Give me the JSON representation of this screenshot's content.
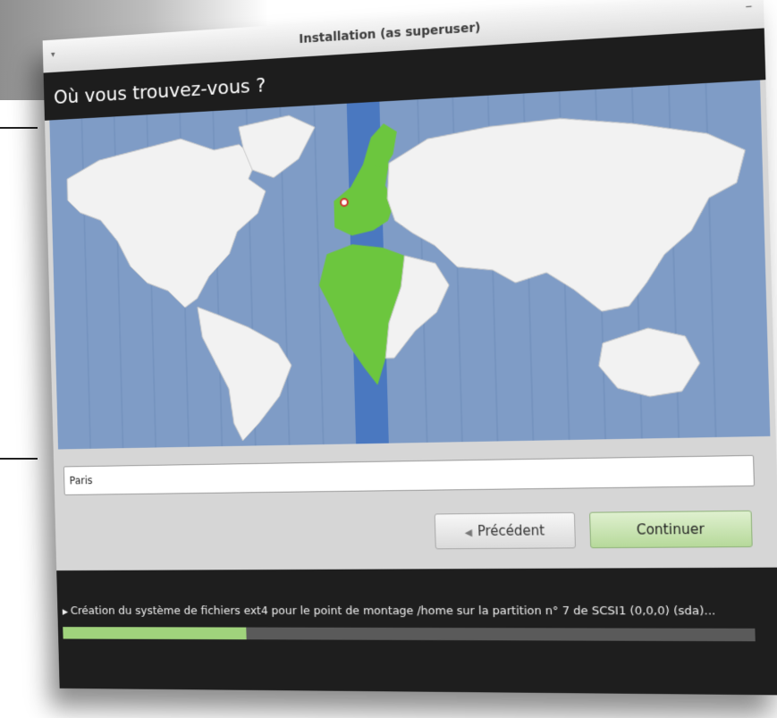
{
  "window": {
    "title": "Installation (as superuser)"
  },
  "header": {
    "heading": "Où vous trouvez-vous ?"
  },
  "map": {
    "selected_marker": "location-pin-icon",
    "highlight_color": "#6cc63e",
    "timezone_band_color": "#4a78c0",
    "ocean_color": "#7f9cc6",
    "land_color": "#f2f2f2"
  },
  "location": {
    "value": "Paris"
  },
  "buttons": {
    "back_label": "Précédent",
    "back_icon": "arrow-left-icon",
    "continue_label": "Continuer"
  },
  "status": {
    "message": "Création du système de fichiers ext4 pour le point de montage /home sur la partition n° 7 de SCSI1 (0,0,0) (sda)...",
    "progress": 0.28
  },
  "colors": {
    "accent_green": "#a0d37c",
    "dark_bar": "#1d1d1d"
  }
}
